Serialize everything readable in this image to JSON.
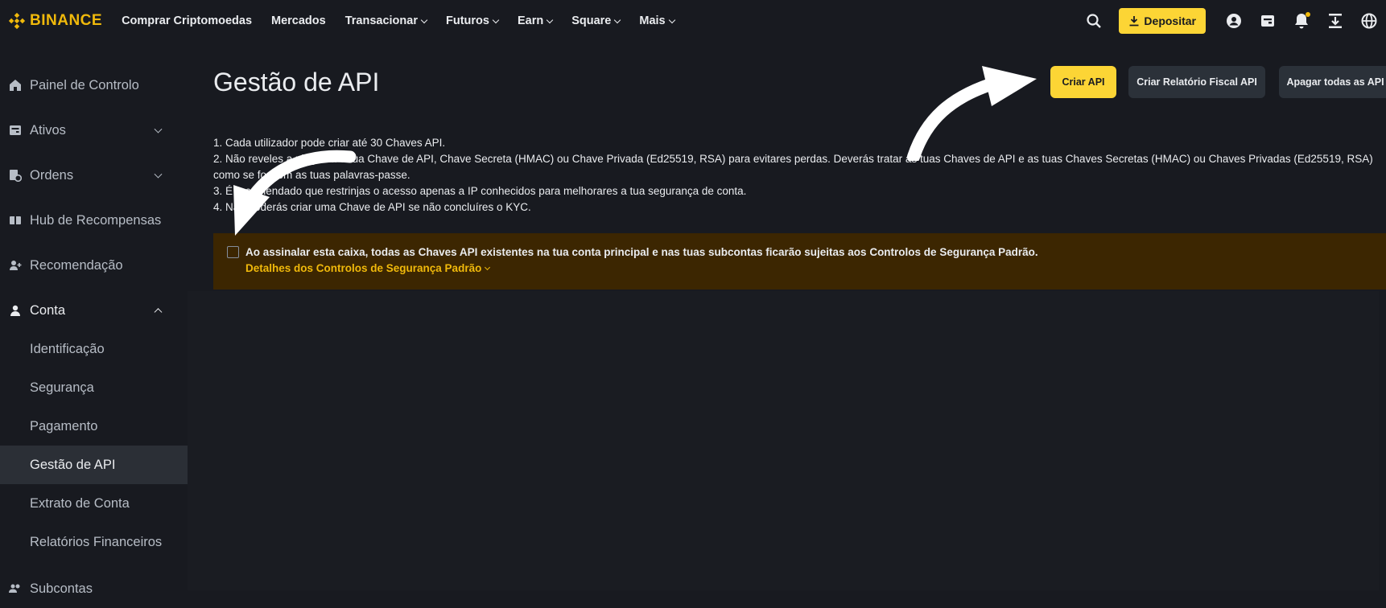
{
  "brand": {
    "name": "BINANCE",
    "color": "#f0b90b"
  },
  "nav": {
    "items": [
      {
        "label": "Comprar Criptomoedas",
        "dropdown": false
      },
      {
        "label": "Mercados",
        "dropdown": false
      },
      {
        "label": "Transacionar",
        "dropdown": true
      },
      {
        "label": "Futuros",
        "dropdown": true
      },
      {
        "label": "Earn",
        "dropdown": true
      },
      {
        "label": "Square",
        "dropdown": true
      },
      {
        "label": "Mais",
        "dropdown": true
      }
    ],
    "deposit_label": "Depositar",
    "icons": [
      "search-icon",
      "user-icon",
      "wallet-icon",
      "bell-icon",
      "download-app-icon",
      "globe-icon"
    ]
  },
  "sidebar": {
    "items": [
      {
        "label": "Painel de Controlo",
        "icon": "home-icon"
      },
      {
        "label": "Ativos",
        "icon": "wallet-icon",
        "expandable": true
      },
      {
        "label": "Ordens",
        "icon": "orders-icon",
        "expandable": true
      },
      {
        "label": "Hub de Recompensas",
        "icon": "rewards-icon"
      },
      {
        "label": "Recomendação",
        "icon": "referral-icon"
      },
      {
        "label": "Conta",
        "icon": "account-icon",
        "expanded": true
      }
    ],
    "account_sub": [
      {
        "label": "Identificação"
      },
      {
        "label": "Segurança"
      },
      {
        "label": "Pagamento"
      },
      {
        "label": "Gestão de API",
        "selected": true
      },
      {
        "label": "Extrato de Conta"
      },
      {
        "label": "Relatórios Financeiros"
      }
    ],
    "last_item": {
      "label": "Subcontas",
      "icon": "subaccounts-icon"
    }
  },
  "main": {
    "title": "Gestão de API",
    "buttons": {
      "create": "Criar API",
      "fiscal": "Criar Relatório Fiscal API",
      "delete_all": "Apagar todas as API"
    },
    "rules": [
      "1. Cada utilizador pode criar até 30 Chaves API.",
      "2. Não reveles a ninguém a tua Chave de API, Chave Secreta (HMAC) ou Chave Privada (Ed25519, RSA) para evitares perdas. Deverás tratar as tuas Chaves de API e as tuas Chaves Secretas (HMAC) ou Chaves Privadas (Ed25519, RSA)",
      "como se fossem as tuas palavras-passe.",
      "3. É recomendado que restrinjas o acesso apenas a IP conhecidos para melhorares a tua segurança de conta.",
      "4. Não poderás criar uma Chave de API se não concluíres o KYC."
    ],
    "notice": {
      "text": "Ao assinalar esta caixa, todas as Chaves API existentes na tua conta principal e nas tuas subcontas ficarão sujeitas aos Controlos de Segurança Padrão.",
      "link": "Detalhes dos Controlos de Segurança Padrão",
      "checked": false
    }
  },
  "colors": {
    "bg": "#181a20",
    "accent": "#fcd535",
    "notice_bg": "#3c2601",
    "selected_bg": "#2b2f36"
  }
}
